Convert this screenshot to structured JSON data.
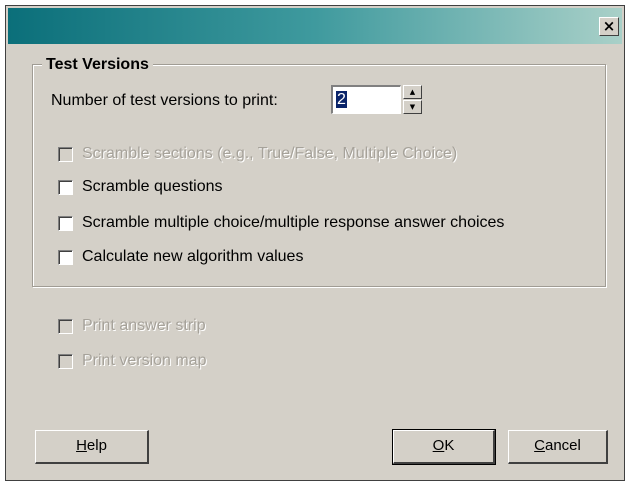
{
  "titlebar": {
    "close_glyph": "×"
  },
  "group": {
    "title": "Test Versions",
    "versions_label": "Number of test versions to print:",
    "versions_value": "2"
  },
  "options": [
    {
      "label": "Scramble sections (e.g., True/False, Multiple Choice)",
      "checked": false,
      "disabled": true
    },
    {
      "label": "Scramble questions",
      "checked": false,
      "disabled": false
    },
    {
      "label": "Scramble multiple choice/multiple response answer choices",
      "checked": false,
      "disabled": false
    },
    {
      "label": "Calculate new algorithm values",
      "checked": false,
      "disabled": false
    }
  ],
  "print_options": [
    {
      "label": "Print answer strip",
      "checked": false,
      "disabled": true
    },
    {
      "label": "Print version map",
      "checked": false,
      "disabled": true
    }
  ],
  "buttons": {
    "help": {
      "mnemonic": "H",
      "rest": "elp"
    },
    "ok": {
      "mnemonic": "O",
      "rest": "K"
    },
    "cancel": {
      "mnemonic": "C",
      "rest": "ancel"
    }
  }
}
